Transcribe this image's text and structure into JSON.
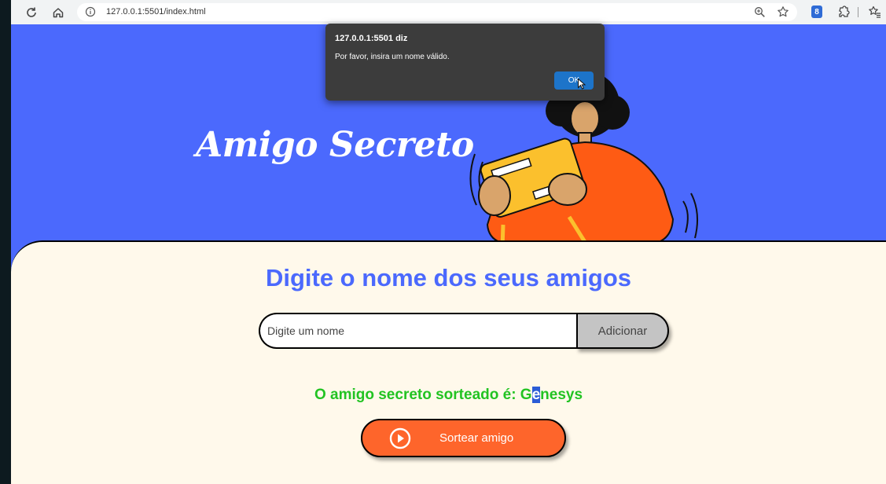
{
  "browser": {
    "url": "127.0.0.1:5501/index.html",
    "extension_badge": "8"
  },
  "hero": {
    "title": "Amigo Secreto"
  },
  "main": {
    "section_title": "Digite o nome dos seus amigos",
    "input_placeholder": "Digite um nome",
    "add_button_label": "Adicionar",
    "result_prefix": "O amigo secreto sorteado é: G",
    "result_highlight": "e",
    "result_suffix": "nesys",
    "draw_button_label": "Sortear amigo"
  },
  "dialog": {
    "title": "127.0.0.1:5501 diz",
    "message": "Por favor, insira um nome válido.",
    "ok_label": "OK"
  },
  "colors": {
    "hero_bg": "#4b69fd",
    "panel_bg": "#fff9eb",
    "accent_orange": "#fe652b",
    "result_green": "#22c322"
  },
  "icons": [
    "reload-icon",
    "home-icon",
    "info-icon",
    "zoom-icon",
    "star-icon",
    "extension-icon",
    "favorites-icon",
    "play-icon"
  ]
}
